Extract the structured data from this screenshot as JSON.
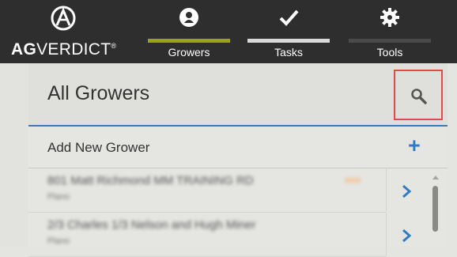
{
  "app": {
    "logo_bold": "AG",
    "logo_rest": "VERDICT",
    "logo_mark": "®"
  },
  "nav": {
    "tabs": [
      {
        "label": "Growers",
        "icon": "person-icon",
        "active": true,
        "bar_color": "#9aa21a"
      },
      {
        "label": "Tasks",
        "icon": "check-icon",
        "active": false,
        "bar_color": "#d9d9d9"
      },
      {
        "label": "Tools",
        "icon": "gear-icon",
        "active": false,
        "bar_color": "#4a4a4a"
      }
    ]
  },
  "main": {
    "title": "All Growers",
    "add_label": "Add New Grower",
    "rows": [
      {
        "title": "801 Matt Richmond MM TRAINING RD",
        "subtitle": "Plano"
      },
      {
        "title": "2/3 Charles 1/3 Nelson and Hugh Miner",
        "subtitle": "Plano"
      }
    ]
  },
  "colors": {
    "accent": "#2f7cc2",
    "highlight_border": "#e24b4b",
    "topbar": "#2e2e2e"
  }
}
